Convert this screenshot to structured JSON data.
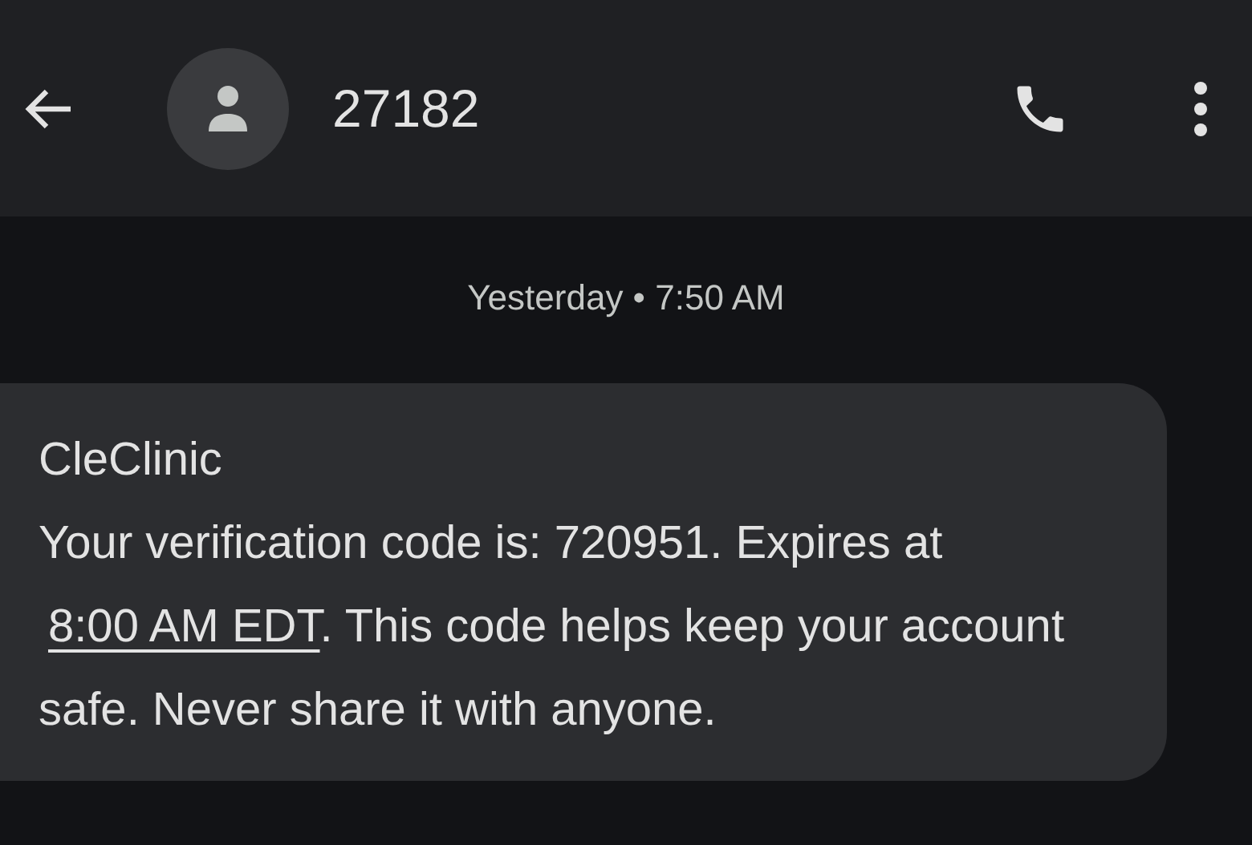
{
  "header": {
    "title": "27182"
  },
  "timestamp": "Yesterday • 7:50 AM",
  "message": {
    "sender": "CleClinic",
    "text_before": "Your verification code is: 720951. Expires at ",
    "link": "8:00 AM EDT",
    "text_after": ". This code helps keep your account safe. Never share it with anyone."
  }
}
